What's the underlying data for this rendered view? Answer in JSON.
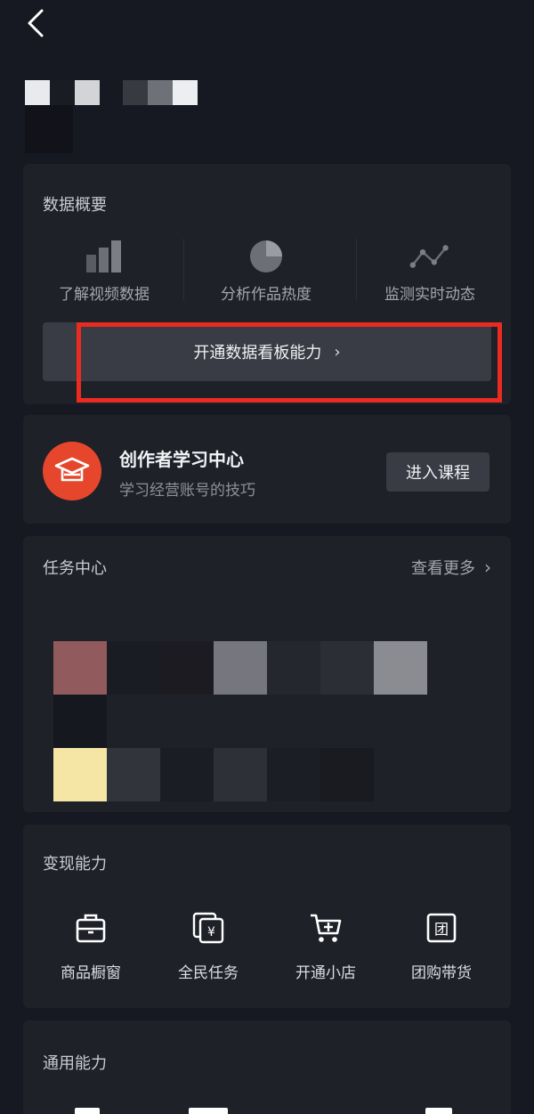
{
  "header": {
    "back_icon": "chevron-left-icon"
  },
  "data_overview": {
    "title": "数据概要",
    "items": [
      {
        "label": "了解视频数据",
        "icon": "bar-chart-icon"
      },
      {
        "label": "分析作品热度",
        "icon": "pie-chart-icon"
      },
      {
        "label": "监测实时动态",
        "icon": "line-trend-icon"
      }
    ],
    "open_button_label": "开通数据看板能力",
    "highlight_color": "#ea2b20"
  },
  "learning_center": {
    "title": "创作者学习中心",
    "subtitle": "学习经营账号的技巧",
    "button_label": "进入课程",
    "logo_color": "#e6462c"
  },
  "task_center": {
    "title": "任务中心",
    "see_more_label": "查看更多"
  },
  "monetize": {
    "title": "变现能力",
    "items": [
      {
        "label": "商品橱窗",
        "icon": "showcase-icon"
      },
      {
        "label": "全民任务",
        "icon": "yuan-task-icon"
      },
      {
        "label": "开通小店",
        "icon": "cart-plus-icon"
      },
      {
        "label": "团购带货",
        "icon": "group-buy-icon"
      }
    ]
  },
  "general": {
    "title": "通用能力"
  }
}
